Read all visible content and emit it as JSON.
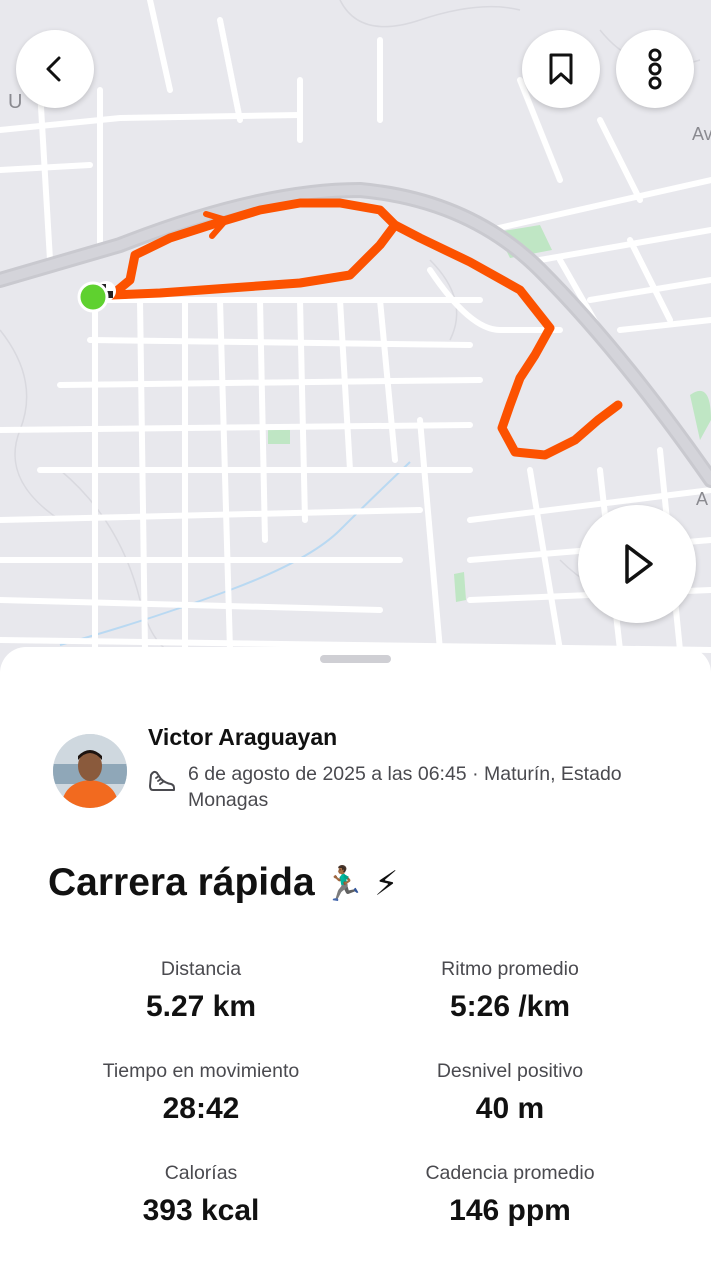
{
  "map": {
    "route_color": "#fc5200",
    "start_marker_color": "#5fd12f",
    "label_top_left": "U",
    "label_right_top": "Av",
    "label_right_bottom": "A"
  },
  "buttons": {
    "back_icon": "chevron-left-icon",
    "bookmark_icon": "bookmark-icon",
    "more_icon": "more-vertical-icon",
    "play_icon": "play-icon"
  },
  "activity": {
    "athlete_name": "Victor Araguayan",
    "date_location": "6 de agosto de 2025 a las 06:45 · Maturín, Estado Monagas",
    "sport_icon": "running-shoe-icon",
    "title": "Carrera rápida",
    "title_emoji": "🏃🏾‍♂️ ⚡"
  },
  "stats": [
    {
      "label": "Distancia",
      "value": "5.27 km"
    },
    {
      "label": "Ritmo promedio",
      "value": "5:26 /km"
    },
    {
      "label": "Tiempo en movimiento",
      "value": "28:42"
    },
    {
      "label": "Desnivel positivo",
      "value": "40 m"
    },
    {
      "label": "Calorías",
      "value": "393 kcal"
    },
    {
      "label": "Cadencia promedio",
      "value": "146 ppm"
    }
  ]
}
